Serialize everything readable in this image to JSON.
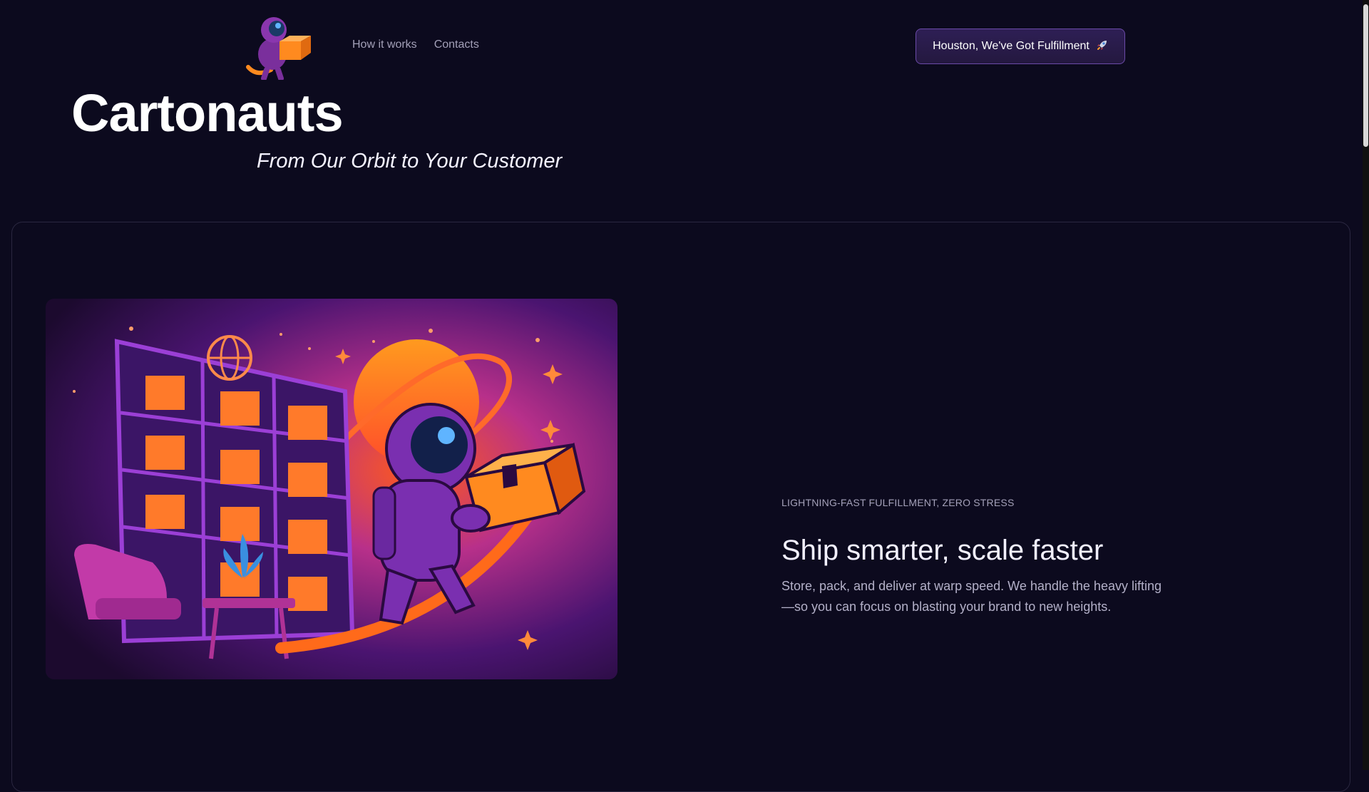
{
  "header": {
    "logo_icon": "astronaut-with-box-logo",
    "nav": [
      {
        "label": "How it works"
      },
      {
        "label": "Contacts"
      }
    ],
    "cta_label": "Houston, We've Got Fulfillment",
    "cta_icon": "rocket-icon"
  },
  "hero": {
    "brand": "Cartonauts",
    "tagline": "From Our Orbit to Your Customer"
  },
  "feature": {
    "image_icon": "astronaut-warehouse-illustration",
    "eyebrow": "LIGHTNING-FAST FULFILLMENT, ZERO STRESS",
    "heading": "Ship smarter, scale faster",
    "description": "Store, pack, and deliver at warp speed. We handle the heavy lifting—so you can focus on blasting your brand to new heights."
  },
  "colors": {
    "background": "#0c0a1e",
    "accent_orange": "#ff7a1a",
    "accent_purple": "#6b2fb3",
    "cta_border": "#6b4aa8"
  }
}
